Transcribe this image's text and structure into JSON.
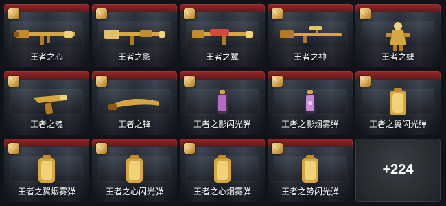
{
  "items": [
    {
      "name": "王者之心",
      "icon": "golden-rifle-icon"
    },
    {
      "name": "王者之影",
      "icon": "golden-rifle-icon"
    },
    {
      "name": "王者之翼",
      "icon": "golden-rifle-icon"
    },
    {
      "name": "王者之神",
      "icon": "golden-sniper-rifle-icon"
    },
    {
      "name": "王者之蝶",
      "icon": "character-figure-icon"
    },
    {
      "name": "王者之魂",
      "icon": "golden-pistol-icon"
    },
    {
      "name": "王者之锋",
      "icon": "golden-blade-icon"
    },
    {
      "name": "王者之影闪光弹",
      "icon": "flashbang-grenade-icon"
    },
    {
      "name": "王者之影烟雾弹",
      "icon": "smoke-grenade-icon"
    },
    {
      "name": "王者之翼闪光弹",
      "icon": "flashbang-grenade-icon"
    },
    {
      "name": "王者之翼烟雾弹",
      "icon": "smoke-grenade-icon"
    },
    {
      "name": "王者之心闪光弹",
      "icon": "flashbang-grenade-icon"
    },
    {
      "name": "王者之心烟雾弹",
      "icon": "smoke-grenade-icon"
    },
    {
      "name": "王者之势闪光弹",
      "icon": "flashbang-grenade-icon"
    }
  ],
  "more_tile": {
    "label": "+224"
  },
  "theme": {
    "tile_top_red": "#a02626",
    "gold": "#d6a640",
    "more_bg": "#2b2e33",
    "label_color": "#ffffff"
  }
}
